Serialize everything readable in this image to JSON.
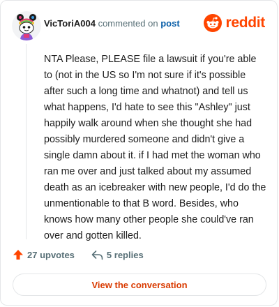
{
  "comment": {
    "username": "VicToriA004",
    "action_text": "commented on",
    "post_link": "post",
    "text": "NTA Please, PLEASE file a lawsuit if you're able to (not in the US so I'm not sure if it's possible after such a long time and whatnot) and tell us what happens, I'd hate to see this \"Ashley\" just happily walk around when she thought she had possibly murdered someone and didn't give a single damn about it. if I had met the woman who ran me over and just talked about my assumed death as an icebreaker with new people, I'd do the unmentionable to that B word. Besides, who knows how many other people she could've ran over and gotten killed."
  },
  "brand": {
    "name": "reddit",
    "color": "#ff4500"
  },
  "stats": {
    "upvotes": "27 upvotes",
    "replies": "5 replies"
  },
  "cta": {
    "label": "View the conversation"
  },
  "icons": {
    "avatar": "snoo-avatar",
    "logo": "reddit-logo-icon",
    "upvote": "upvote-arrow-icon",
    "reply": "reply-arrow-icon"
  },
  "colors": {
    "accent": "#ff4500",
    "link": "#0a5fa8",
    "cta": "#d93a00",
    "muted": "#576f76"
  }
}
